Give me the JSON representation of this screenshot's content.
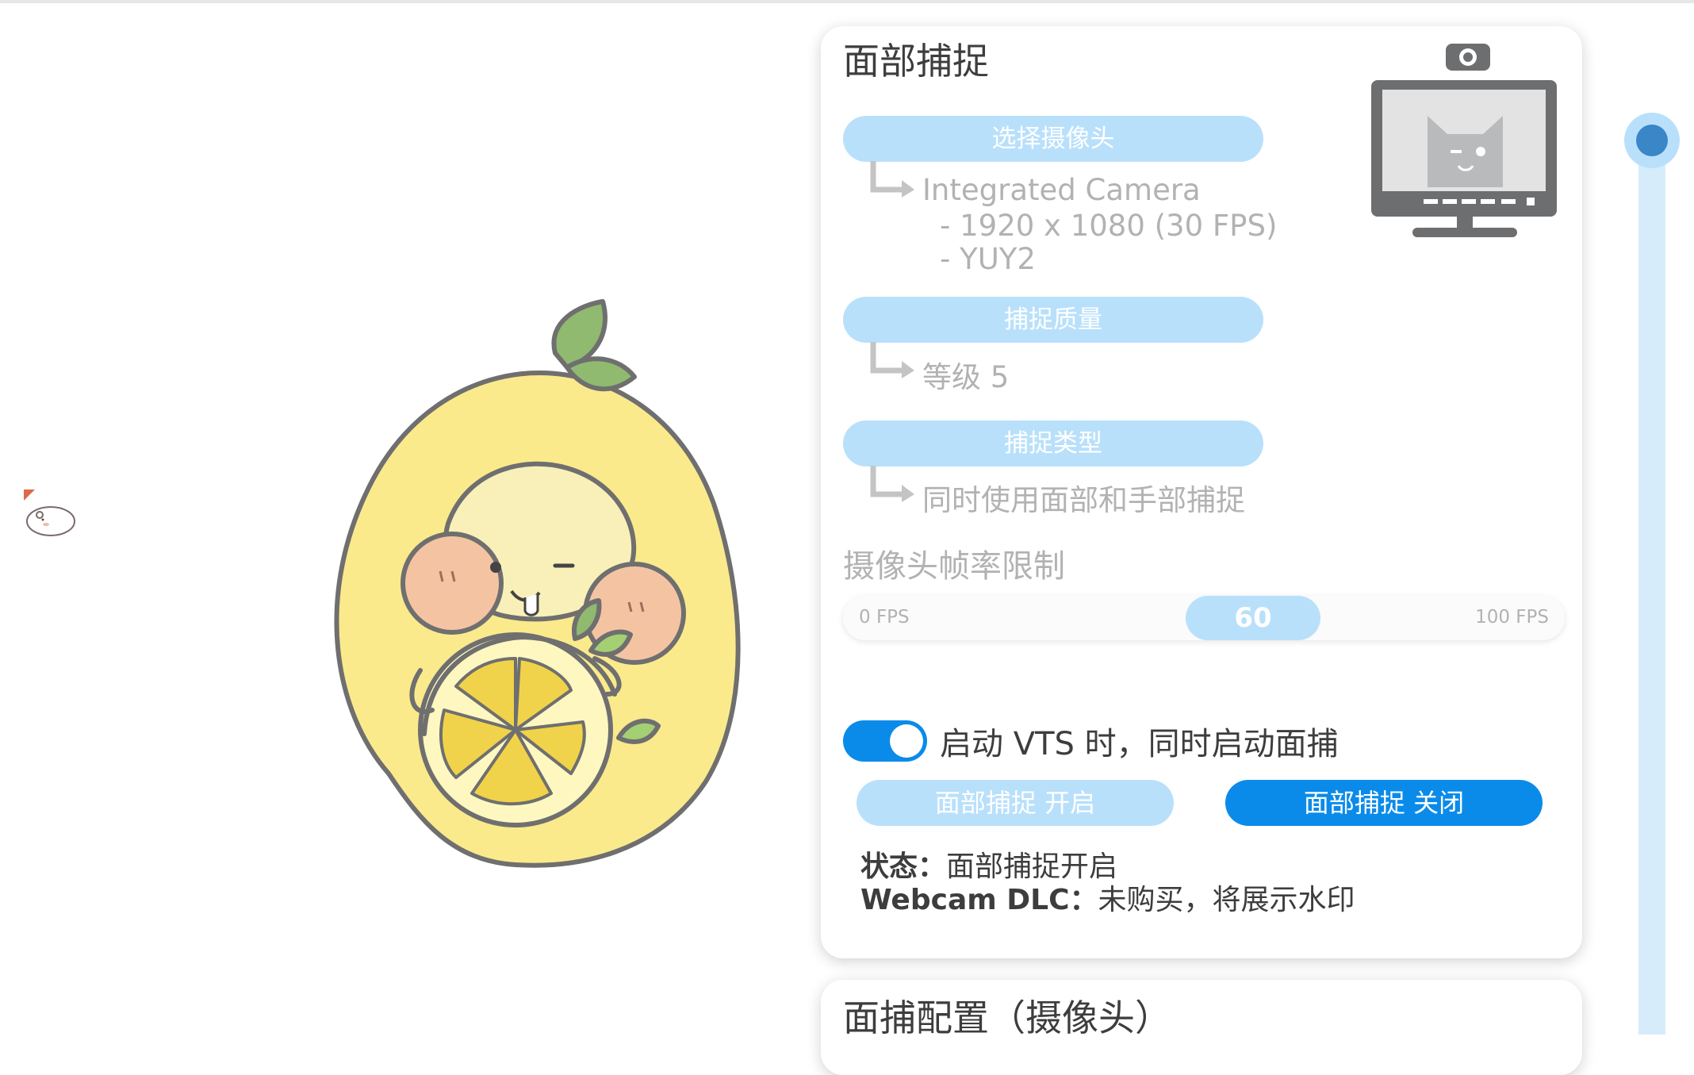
{
  "face_capture": {
    "title": "面部捕捉",
    "camera_button": "选择摄像头",
    "camera_name": "Integrated Camera",
    "camera_resolution": "- 1920 x 1080 (30 FPS)",
    "camera_format": "- YUY2",
    "quality_button": "捕捉质量",
    "quality_value": "等级 5",
    "type_button": "捕捉类型",
    "type_value": "同时使用面部和手部捕捉",
    "fps_limit_label": "摄像头帧率限制",
    "fps_min_label": "0 FPS",
    "fps_value": "60",
    "fps_max_label": "100 FPS",
    "fps_fraction": 0.6,
    "autostart_label": "启动 VTS 时，同时启动面捕",
    "autostart_enabled": true,
    "start_button": "面部捕捉 开启",
    "stop_button": "面部捕捉 关闭",
    "status_key": "状态：",
    "status_value": "面部捕捉开启",
    "dlc_key": "Webcam DLC：",
    "dlc_value": "未购买，将展示水印"
  },
  "face_config": {
    "title": "面捕配置（摄像头）"
  },
  "colors": {
    "accent": "#0a8bea",
    "pill_light": "#b9e0fb",
    "text_gray": "#b2b2b2",
    "text_dark": "#3d3d3d"
  },
  "icons": {
    "monitor": "webcam-monitor-cat-icon",
    "arrow": "corner-arrow-icon",
    "mascot": "lemon-mascot"
  }
}
